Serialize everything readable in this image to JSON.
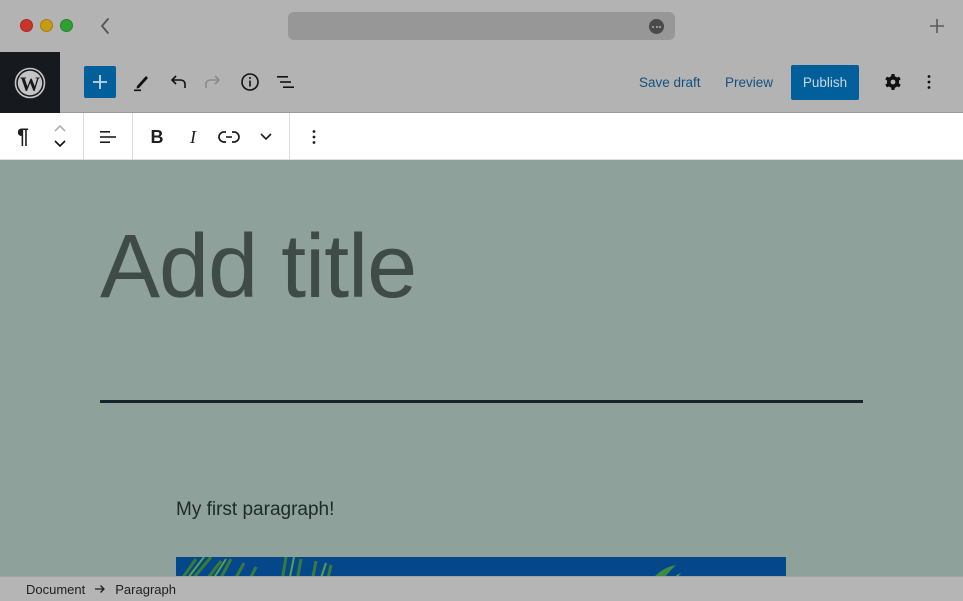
{
  "browser": {
    "back_icon": "chevron-left-icon",
    "url_more_icon": "ellipsis-icon",
    "new_tab_icon": "plus-icon"
  },
  "header": {
    "logo_icon": "wordpress-logo-icon",
    "add_block_icon": "plus-icon",
    "tools_icon": "pencil-icon",
    "undo_icon": "undo-icon",
    "redo_icon": "redo-icon",
    "details_icon": "info-icon",
    "list_view_icon": "list-view-icon",
    "save_draft_label": "Save draft",
    "preview_label": "Preview",
    "publish_label": "Publish",
    "settings_icon": "gear-icon",
    "options_icon": "vertical-ellipsis-icon",
    "accent_color": "#01609b"
  },
  "block_toolbar": {
    "block_type_icon": "paragraph-icon",
    "block_type_glyph": "¶",
    "move_up_icon": "chevron-up-icon",
    "move_down_icon": "chevron-down-icon",
    "align_icon": "align-left-icon",
    "bold_label": "B",
    "italic_label": "I",
    "link_icon": "link-icon",
    "more_icon": "chevron-down-icon",
    "options_icon": "vertical-ellipsis-icon"
  },
  "editor": {
    "title_placeholder": "Add title",
    "paragraph_text": "My first paragraph!"
  },
  "footer": {
    "breadcrumbs": [
      "Document",
      "Paragraph"
    ]
  }
}
